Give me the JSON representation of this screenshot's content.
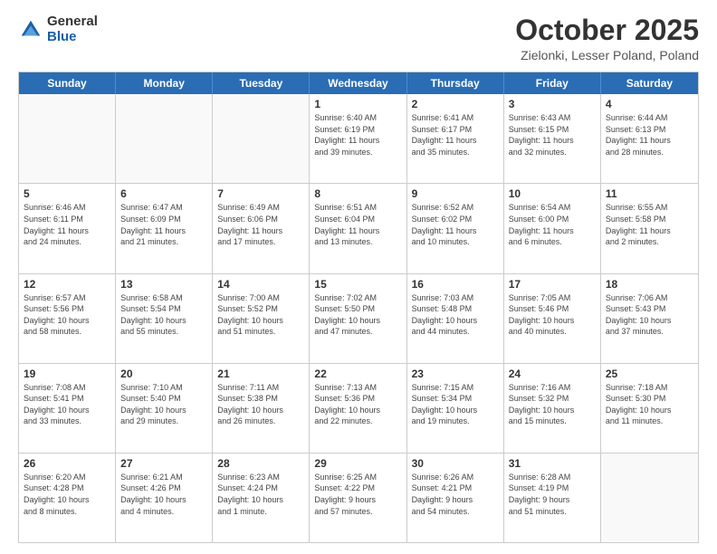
{
  "header": {
    "logo_general": "General",
    "logo_blue": "Blue",
    "month_title": "October 2025",
    "location": "Zielonki, Lesser Poland, Poland"
  },
  "days_of_week": [
    "Sunday",
    "Monday",
    "Tuesday",
    "Wednesday",
    "Thursday",
    "Friday",
    "Saturday"
  ],
  "weeks": [
    [
      {
        "day": "",
        "info": ""
      },
      {
        "day": "",
        "info": ""
      },
      {
        "day": "",
        "info": ""
      },
      {
        "day": "1",
        "info": "Sunrise: 6:40 AM\nSunset: 6:19 PM\nDaylight: 11 hours\nand 39 minutes."
      },
      {
        "day": "2",
        "info": "Sunrise: 6:41 AM\nSunset: 6:17 PM\nDaylight: 11 hours\nand 35 minutes."
      },
      {
        "day": "3",
        "info": "Sunrise: 6:43 AM\nSunset: 6:15 PM\nDaylight: 11 hours\nand 32 minutes."
      },
      {
        "day": "4",
        "info": "Sunrise: 6:44 AM\nSunset: 6:13 PM\nDaylight: 11 hours\nand 28 minutes."
      }
    ],
    [
      {
        "day": "5",
        "info": "Sunrise: 6:46 AM\nSunset: 6:11 PM\nDaylight: 11 hours\nand 24 minutes."
      },
      {
        "day": "6",
        "info": "Sunrise: 6:47 AM\nSunset: 6:09 PM\nDaylight: 11 hours\nand 21 minutes."
      },
      {
        "day": "7",
        "info": "Sunrise: 6:49 AM\nSunset: 6:06 PM\nDaylight: 11 hours\nand 17 minutes."
      },
      {
        "day": "8",
        "info": "Sunrise: 6:51 AM\nSunset: 6:04 PM\nDaylight: 11 hours\nand 13 minutes."
      },
      {
        "day": "9",
        "info": "Sunrise: 6:52 AM\nSunset: 6:02 PM\nDaylight: 11 hours\nand 10 minutes."
      },
      {
        "day": "10",
        "info": "Sunrise: 6:54 AM\nSunset: 6:00 PM\nDaylight: 11 hours\nand 6 minutes."
      },
      {
        "day": "11",
        "info": "Sunrise: 6:55 AM\nSunset: 5:58 PM\nDaylight: 11 hours\nand 2 minutes."
      }
    ],
    [
      {
        "day": "12",
        "info": "Sunrise: 6:57 AM\nSunset: 5:56 PM\nDaylight: 10 hours\nand 58 minutes."
      },
      {
        "day": "13",
        "info": "Sunrise: 6:58 AM\nSunset: 5:54 PM\nDaylight: 10 hours\nand 55 minutes."
      },
      {
        "day": "14",
        "info": "Sunrise: 7:00 AM\nSunset: 5:52 PM\nDaylight: 10 hours\nand 51 minutes."
      },
      {
        "day": "15",
        "info": "Sunrise: 7:02 AM\nSunset: 5:50 PM\nDaylight: 10 hours\nand 47 minutes."
      },
      {
        "day": "16",
        "info": "Sunrise: 7:03 AM\nSunset: 5:48 PM\nDaylight: 10 hours\nand 44 minutes."
      },
      {
        "day": "17",
        "info": "Sunrise: 7:05 AM\nSunset: 5:46 PM\nDaylight: 10 hours\nand 40 minutes."
      },
      {
        "day": "18",
        "info": "Sunrise: 7:06 AM\nSunset: 5:43 PM\nDaylight: 10 hours\nand 37 minutes."
      }
    ],
    [
      {
        "day": "19",
        "info": "Sunrise: 7:08 AM\nSunset: 5:41 PM\nDaylight: 10 hours\nand 33 minutes."
      },
      {
        "day": "20",
        "info": "Sunrise: 7:10 AM\nSunset: 5:40 PM\nDaylight: 10 hours\nand 29 minutes."
      },
      {
        "day": "21",
        "info": "Sunrise: 7:11 AM\nSunset: 5:38 PM\nDaylight: 10 hours\nand 26 minutes."
      },
      {
        "day": "22",
        "info": "Sunrise: 7:13 AM\nSunset: 5:36 PM\nDaylight: 10 hours\nand 22 minutes."
      },
      {
        "day": "23",
        "info": "Sunrise: 7:15 AM\nSunset: 5:34 PM\nDaylight: 10 hours\nand 19 minutes."
      },
      {
        "day": "24",
        "info": "Sunrise: 7:16 AM\nSunset: 5:32 PM\nDaylight: 10 hours\nand 15 minutes."
      },
      {
        "day": "25",
        "info": "Sunrise: 7:18 AM\nSunset: 5:30 PM\nDaylight: 10 hours\nand 11 minutes."
      }
    ],
    [
      {
        "day": "26",
        "info": "Sunrise: 6:20 AM\nSunset: 4:28 PM\nDaylight: 10 hours\nand 8 minutes."
      },
      {
        "day": "27",
        "info": "Sunrise: 6:21 AM\nSunset: 4:26 PM\nDaylight: 10 hours\nand 4 minutes."
      },
      {
        "day": "28",
        "info": "Sunrise: 6:23 AM\nSunset: 4:24 PM\nDaylight: 10 hours\nand 1 minute."
      },
      {
        "day": "29",
        "info": "Sunrise: 6:25 AM\nSunset: 4:22 PM\nDaylight: 9 hours\nand 57 minutes."
      },
      {
        "day": "30",
        "info": "Sunrise: 6:26 AM\nSunset: 4:21 PM\nDaylight: 9 hours\nand 54 minutes."
      },
      {
        "day": "31",
        "info": "Sunrise: 6:28 AM\nSunset: 4:19 PM\nDaylight: 9 hours\nand 51 minutes."
      },
      {
        "day": "",
        "info": ""
      }
    ]
  ]
}
